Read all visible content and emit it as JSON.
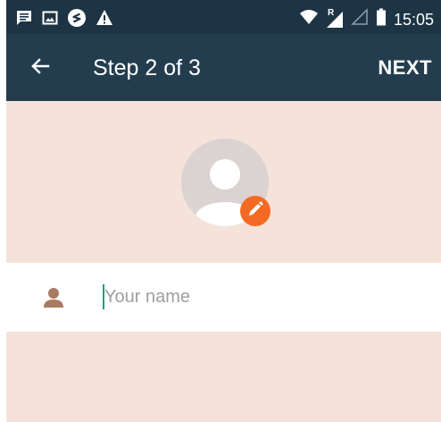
{
  "status_bar": {
    "icons": [
      "message-icon",
      "image-icon",
      "circle-s-icon",
      "warning-icon",
      "wifi-icon",
      "signal-roaming-icon",
      "signal-empty-icon",
      "battery-icon"
    ],
    "roaming_label": "R",
    "time": "15:05"
  },
  "toolbar": {
    "back_icon": "arrow-left-icon",
    "title": "Step 2 of 3",
    "next_label": "NEXT"
  },
  "profile": {
    "avatar_icon": "person-avatar-icon",
    "edit_icon": "pencil-icon"
  },
  "name_field": {
    "icon": "person-icon",
    "placeholder": "Your name",
    "value": ""
  },
  "colors": {
    "status_bar": "#1d3445",
    "toolbar": "#233d4f",
    "background": "#f5e3db",
    "accent": "#f46a24",
    "field_icon": "#a87b62",
    "caret": "#1a9e8a"
  }
}
